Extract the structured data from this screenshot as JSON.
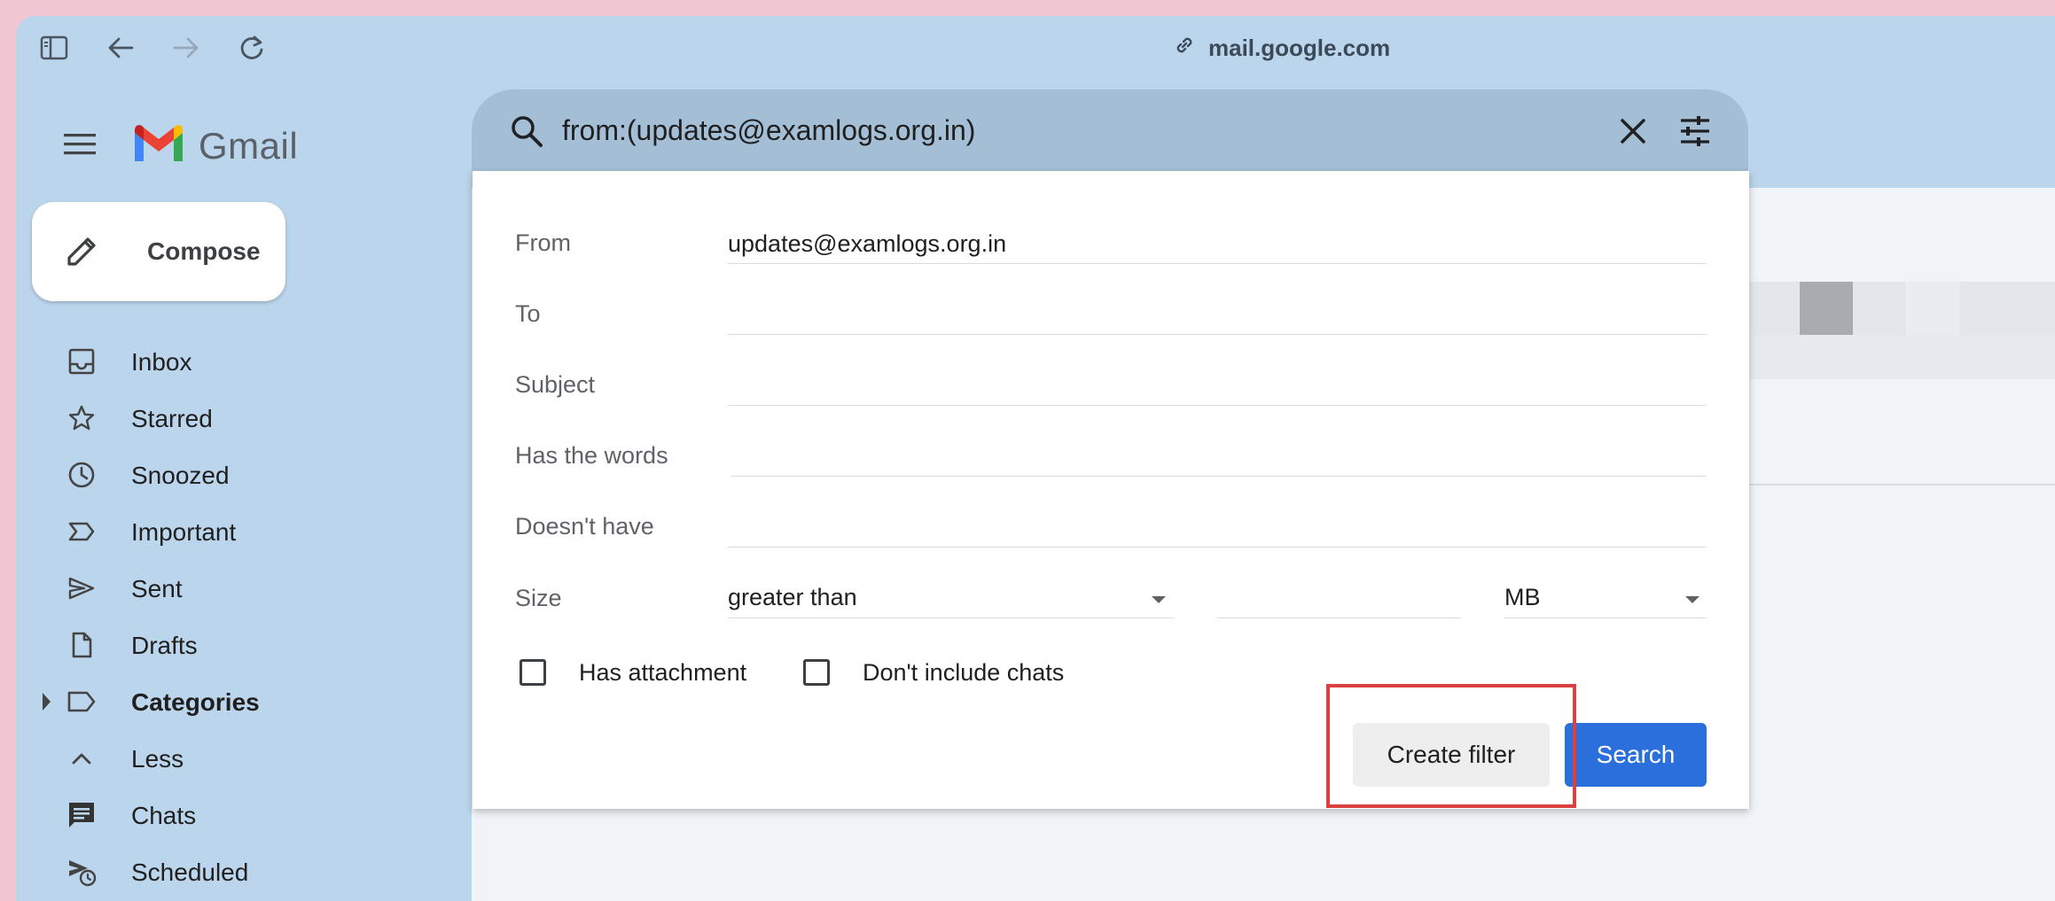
{
  "browser": {
    "url": "mail.google.com"
  },
  "gmail": {
    "logo_text": "Gmail"
  },
  "search": {
    "query": "from:(updates@examlogs.org.in)"
  },
  "compose": {
    "label": "Compose"
  },
  "sidebar": {
    "items": [
      {
        "label": "Inbox",
        "icon": "inbox-icon"
      },
      {
        "label": "Starred",
        "icon": "star-icon"
      },
      {
        "label": "Snoozed",
        "icon": "clock-icon"
      },
      {
        "label": "Important",
        "icon": "important-icon"
      },
      {
        "label": "Sent",
        "icon": "send-icon"
      },
      {
        "label": "Drafts",
        "icon": "draft-icon"
      },
      {
        "label": "Categories",
        "icon": "label-icon"
      },
      {
        "label": "Less",
        "icon": "chevron-up-icon"
      },
      {
        "label": "Chats",
        "icon": "chat-icon"
      },
      {
        "label": "Scheduled",
        "icon": "scheduled-icon"
      }
    ]
  },
  "filter_panel": {
    "from_label": "From",
    "from_value": "updates@examlogs.org.in",
    "to_label": "To",
    "to_value": "",
    "subject_label": "Subject",
    "subject_value": "",
    "has_words_label": "Has the words",
    "has_words_value": "",
    "doesnt_have_label": "Doesn't have",
    "doesnt_have_value": "",
    "size_label": "Size",
    "size_operator": "greater than",
    "size_value": "",
    "size_unit": "MB",
    "has_attachment_label": "Has attachment",
    "has_attachment_checked": false,
    "dont_include_chats_label": "Don't include chats",
    "dont_include_chats_checked": false,
    "create_filter_label": "Create filter",
    "search_label": "Search"
  },
  "colors": {
    "sidebar_bg": "#bbd5ec",
    "search_button": "#2a6fdb",
    "highlight": "#d9403e"
  }
}
